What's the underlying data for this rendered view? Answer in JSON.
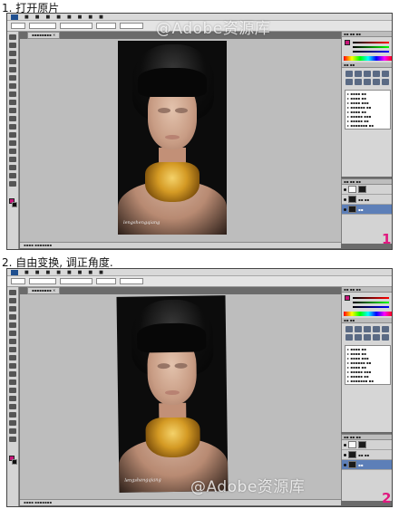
{
  "steps": [
    {
      "title": "1. 打开原片",
      "number": "1",
      "watermark": "@Adobe资源库"
    },
    {
      "title": "2. 自由变换, 调正角度.",
      "number": "2",
      "watermark": "@Adobe资源库"
    }
  ],
  "photo": {
    "signature": "lengshengqiang"
  },
  "colors": {
    "foreground": "#c8157a",
    "background": "#111111",
    "accent": "#e0197f"
  }
}
